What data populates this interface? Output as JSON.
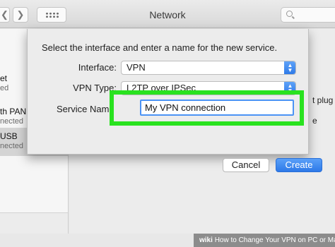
{
  "window": {
    "title": "Network",
    "nav_back": "❮",
    "nav_forward": "❯"
  },
  "sidebar": {
    "services": [
      {
        "name": "et",
        "status": "ed"
      },
      {
        "name": "th PAN",
        "status": "nected"
      },
      {
        "name": "USB",
        "status": "nected"
      }
    ]
  },
  "detail": {
    "status_fragment": "t plug",
    "status_fragment2": "e"
  },
  "sheet": {
    "instructions": "Select the interface and enter a name for the new service.",
    "interface_label": "Interface:",
    "interface_value": "VPN",
    "vpn_type_label": "VPN Type:",
    "vpn_type_value": "L2TP over IPSec",
    "service_name_label": "Service Name",
    "service_name_value": "My VPN connection",
    "stepper_glyph": "▲▼",
    "cancel_label": "Cancel",
    "create_label": "Create"
  },
  "footer": {
    "brand": "wiki",
    "text": "How to Change Your VPN on PC or Mac"
  },
  "colors": {
    "accent_blue": "#3a85f0",
    "highlight_green": "#29e21f"
  },
  "icons": [
    "back-chevron-icon",
    "forward-chevron-icon",
    "show-all-grid-icon",
    "search-icon",
    "popup-stepper-icon"
  ]
}
